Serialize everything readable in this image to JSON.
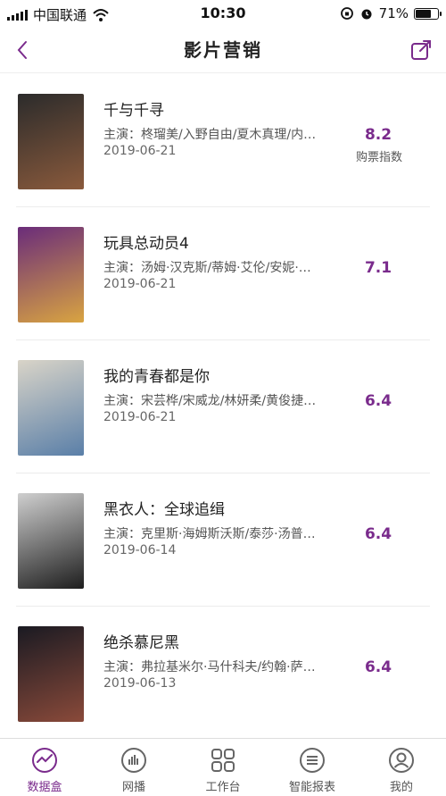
{
  "status_bar": {
    "carrier": "中国联通",
    "time": "10:30",
    "battery_percent": "71%",
    "battery_level": 0.71
  },
  "nav": {
    "title": "影片营销",
    "back_icon": "chevron-left-icon",
    "share_icon": "share-icon"
  },
  "score_label": "购票指数",
  "movies": [
    {
      "title": "千与千寻",
      "cast": "主演：柊瑠美/入野自由/夏木真理/内…",
      "date": "2019-06-21",
      "score": "8.2",
      "poster_colors": [
        "#2b2b2b",
        "#8a5a3c"
      ]
    },
    {
      "title": "玩具总动员4",
      "cast": "主演：汤姆·汉克斯/蒂姆·艾伦/安妮·…",
      "date": "2019-06-21",
      "score": "7.1",
      "poster_colors": [
        "#6a2c7a",
        "#d9a441"
      ]
    },
    {
      "title": "我的青春都是你",
      "cast": "主演：宋芸桦/宋威龙/林妍柔/黄俊捷…",
      "date": "2019-06-21",
      "score": "6.4",
      "poster_colors": [
        "#d9d4c8",
        "#5a7fa8"
      ]
    },
    {
      "title": "黑衣人：全球追缉",
      "cast": "主演：克里斯·海姆斯沃斯/泰莎·汤普…",
      "date": "2019-06-14",
      "score": "6.4",
      "poster_colors": [
        "#cfcfcf",
        "#1e1e1e"
      ]
    },
    {
      "title": "绝杀慕尼黑",
      "cast": "主演：弗拉基米尔·马什科夫/约翰·萨…",
      "date": "2019-06-13",
      "score": "6.4",
      "poster_colors": [
        "#1a1a22",
        "#8a4a3a"
      ]
    }
  ],
  "tabs": [
    {
      "label": "数据盒",
      "icon": "data-box-icon",
      "active": true
    },
    {
      "label": "网播",
      "icon": "stream-chart-icon",
      "active": false
    },
    {
      "label": "工作台",
      "icon": "workbench-grid-icon",
      "active": false
    },
    {
      "label": "智能报表",
      "icon": "report-list-icon",
      "active": false
    },
    {
      "label": "我的",
      "icon": "user-icon",
      "active": false
    }
  ],
  "colors": {
    "accent": "#7a2b8c",
    "divider": "#ececec"
  }
}
